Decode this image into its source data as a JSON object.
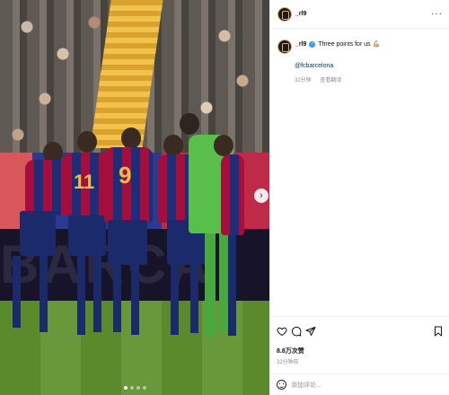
{
  "post": {
    "username": "_rl9",
    "caption_username": "_rl9",
    "caption_text": "Three points for us 💪🏼",
    "mention": "@fcbarcelona",
    "time_short": "32分钟",
    "see_translation": "查看翻译",
    "likes": "8.8万次赞",
    "time_ago": "32分钟前",
    "more_label": "···"
  },
  "photo": {
    "board_text": "BARCA",
    "shirt_numbers": [
      "11",
      "9"
    ],
    "carousel_dots": 4,
    "active_dot": 0
  },
  "comment": {
    "placeholder": "添加评论..."
  },
  "icons": {
    "verified": "verified-badge-icon",
    "like": "heart-icon",
    "comment": "comment-icon",
    "share": "send-icon",
    "save": "bookmark-icon",
    "emoji": "emoji-icon",
    "next": "chevron-right-icon"
  },
  "colors": {
    "link": "#00376b",
    "verified": "#3897f0",
    "muted": "#8e8e8e"
  }
}
